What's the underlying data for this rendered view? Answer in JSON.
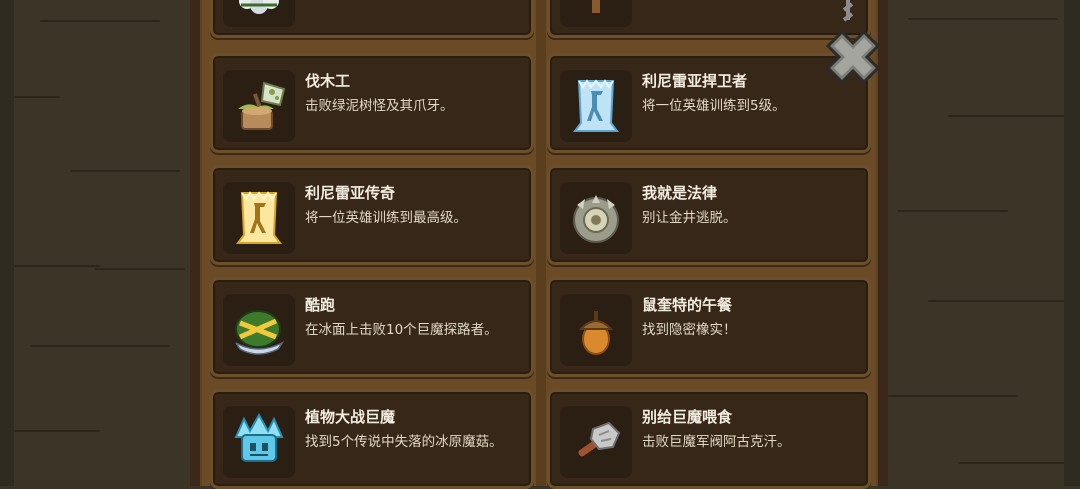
{
  "achievements": [
    {
      "title": "",
      "desc": "",
      "icon": "snow-plant-icon"
    },
    {
      "title": "",
      "desc": "",
      "icon": "torch-icon"
    },
    {
      "title": "伐木工",
      "desc": "击败绿泥树怪及其爪牙。",
      "icon": "axe-stump-icon"
    },
    {
      "title": "利尼雷亚捍卫者",
      "desc": "将一位英雄训练到5级。",
      "icon": "blue-banner-hero-icon"
    },
    {
      "title": "利尼雷亚传奇",
      "desc": "将一位英雄训练到最高级。",
      "icon": "gold-banner-hero-icon"
    },
    {
      "title": "我就是法律",
      "desc": "别让金井逃脱。",
      "icon": "spiked-shield-icon"
    },
    {
      "title": "酷跑",
      "desc": "在冰面上击败10个巨魔探路者。",
      "icon": "troll-helmet-icon"
    },
    {
      "title": "鼠奎特的午餐",
      "desc": "找到隐密橡实！",
      "icon": "acorn-icon"
    },
    {
      "title": "植物大战巨魔",
      "desc": "找到5个传说中失落的冰原魔菇。",
      "icon": "ice-mushroom-icon"
    },
    {
      "title": "别给巨魔喂食",
      "desc": "击败巨魔军阀阿古克汗。",
      "icon": "stone-club-icon"
    }
  ],
  "close_button": {
    "icon": "close-x-icon"
  }
}
